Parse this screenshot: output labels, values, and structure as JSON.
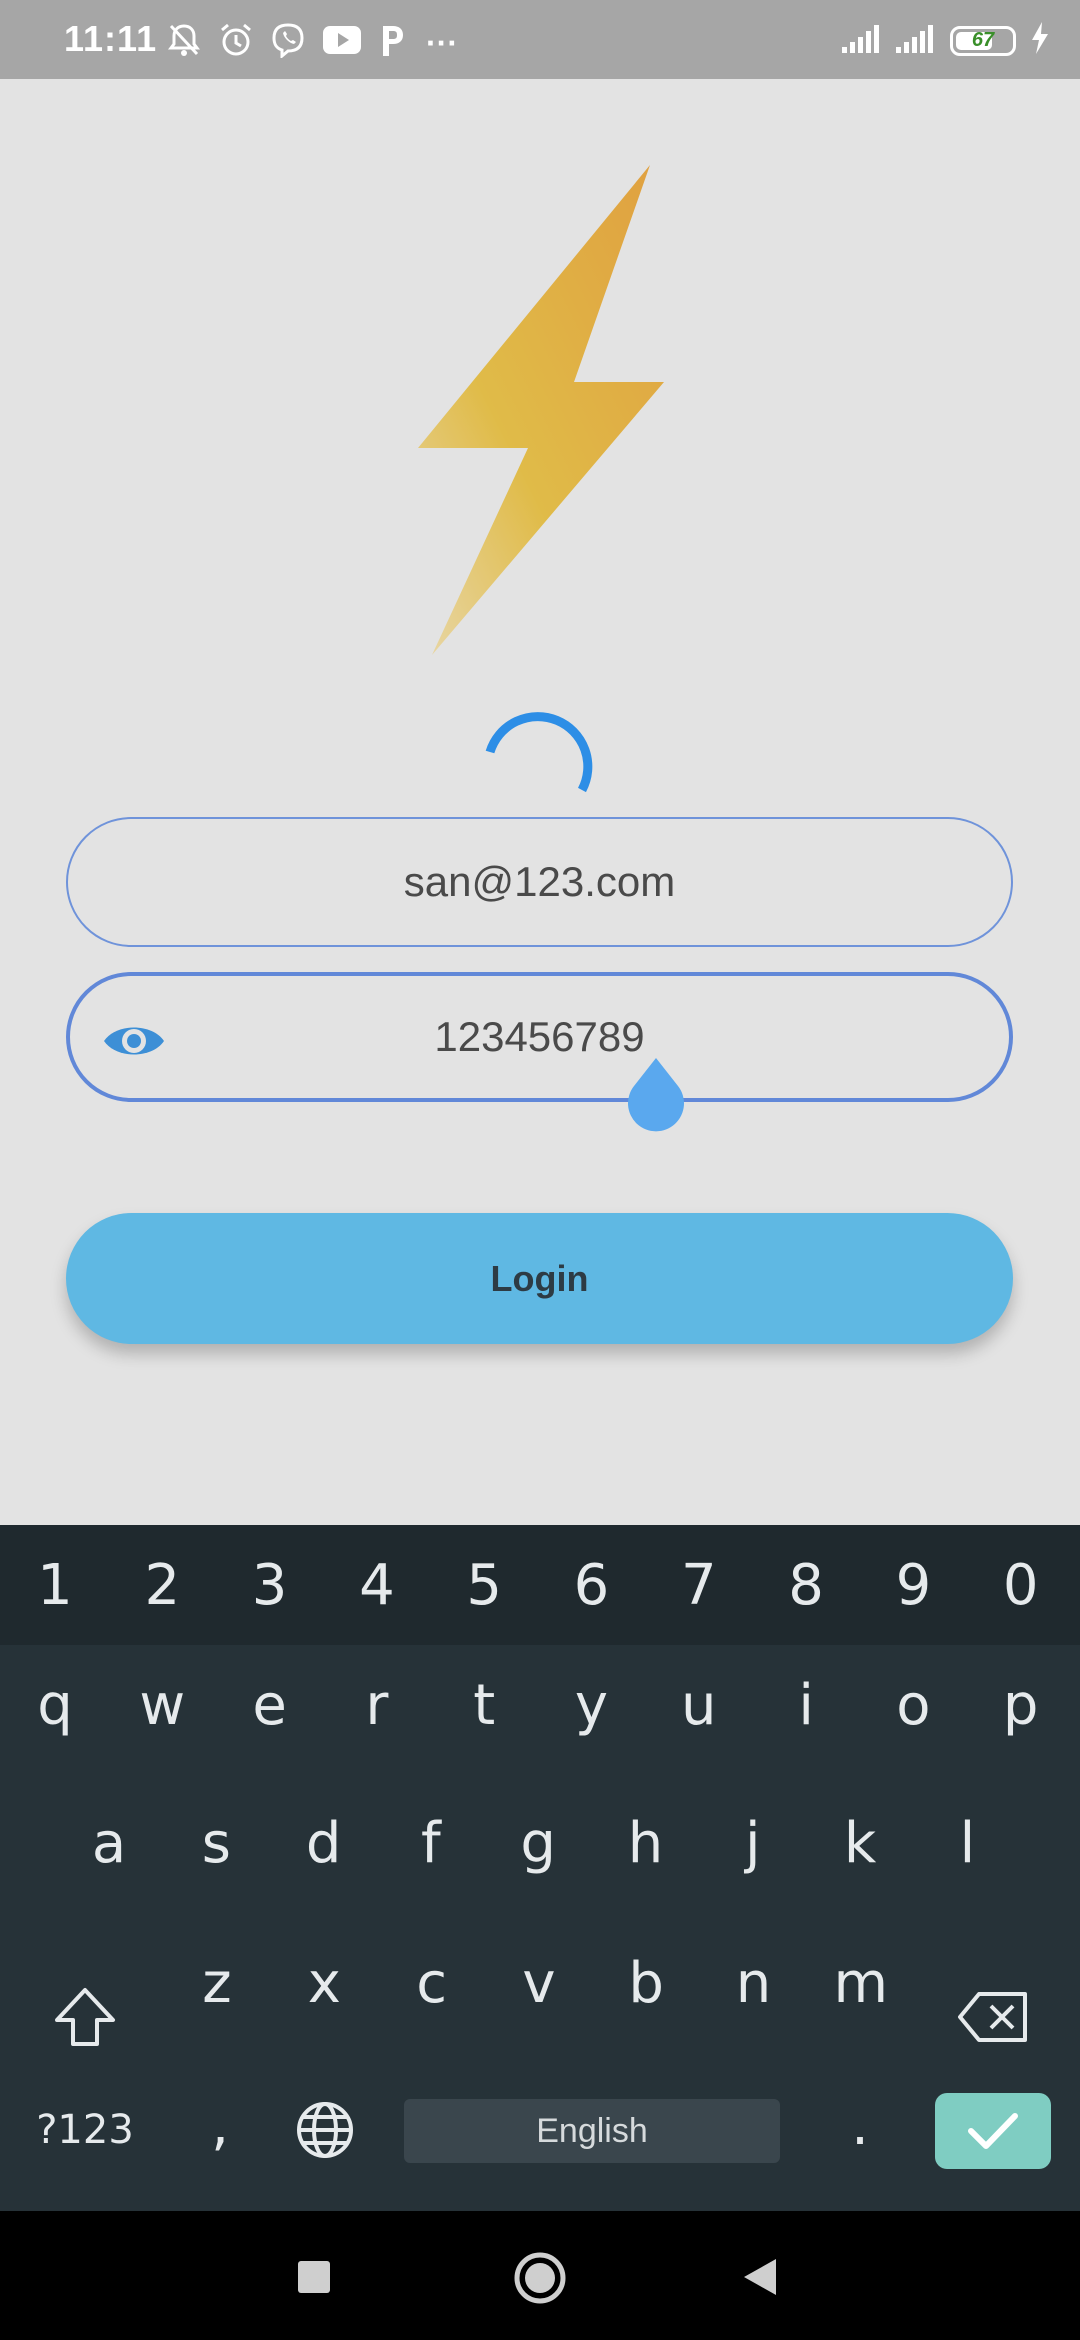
{
  "status_bar": {
    "time": "11:11",
    "left_icons": [
      "mute-icon",
      "alarm-icon",
      "viber-icon",
      "youtube-icon",
      "p-app-icon"
    ],
    "more": "···",
    "battery_percent": "67",
    "battery_level": 0.67
  },
  "login": {
    "email_value": "san@123.com",
    "password_value": "123456789",
    "button_label": "Login",
    "accent_color": "#5fb8e3",
    "field_border_color": "#6f93da"
  },
  "keyboard": {
    "number_row": [
      "1",
      "2",
      "3",
      "4",
      "5",
      "6",
      "7",
      "8",
      "9",
      "0"
    ],
    "row1": [
      "q",
      "w",
      "e",
      "r",
      "t",
      "y",
      "u",
      "i",
      "o",
      "p"
    ],
    "row2": [
      "a",
      "s",
      "d",
      "f",
      "g",
      "h",
      "j",
      "k",
      "l"
    ],
    "row3": [
      "z",
      "x",
      "c",
      "v",
      "b",
      "n",
      "m"
    ],
    "symbols_key": "?123",
    "comma_key": ",",
    "space_label": "English",
    "period_key": "."
  }
}
